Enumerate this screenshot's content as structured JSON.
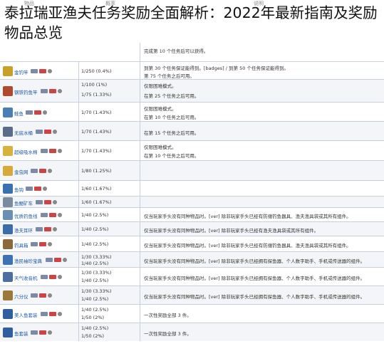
{
  "title": "泰拉瑞亚渔夫任务奖励全面解析：2022年最新指南及奖励物品总览",
  "header": {
    "col_item": "物品",
    "col_rate": "概率",
    "col_note": "说明"
  },
  "top_rows": [
    {
      "note": "完成第 10 个任务后可以获得。"
    }
  ],
  "rows": [
    {
      "name": "金钓竿",
      "rate1": "1/250 (0.4%)",
      "rate2": "",
      "note1": "到第 30 个任务保证能得到。[badges] / 到第 50 个任务保证能得到。",
      "note2": "第 75 个任务之后可用。",
      "icon": "golden-fishing-rod-icon"
    },
    {
      "name": "钢铁钓鱼竿",
      "rate1": "1/100 (1%)",
      "rate2": "1/75 (1.33%)",
      "note1": "仅限困难模式。",
      "note2": "在第 25 个任务之后可用。",
      "icon": "fishing-rod-icon"
    },
    {
      "name": "鲑鱼",
      "rate1": "1/70 (1.43%)",
      "rate2": "",
      "note1": "仅限困难模式。",
      "note2": "在第 10 个任务之后可用。",
      "icon": "fish-icon"
    },
    {
      "name": "无底水桶",
      "rate1": "1/70 (1.43%)",
      "rate2": "",
      "note1": "在第 15 个任务之后可用。",
      "note2": "",
      "icon": "bucket-icon"
    },
    {
      "name": "超级吸水棉",
      "rate1": "1/70 (1.43%)",
      "rate2": "",
      "note1": "仅限困难模式。",
      "note2": "在第 10 个任务之后可用。",
      "icon": "sponge-icon"
    },
    {
      "name": "金虫网",
      "rate1": "1/80 (1.25%)",
      "rate2": "",
      "note1": "",
      "note2": "",
      "icon": "bug-net-icon"
    },
    {
      "name": "鱼钩",
      "rate1": "1/60 (1.67%)",
      "rate2": "",
      "note1": "",
      "note2": "",
      "icon": "fish-hook-icon"
    },
    {
      "name": "鱼鳃矿车",
      "rate1": "1/60 (1.67%)",
      "rate2": "",
      "note1": "",
      "note2": "",
      "icon": "minecart-icon"
    },
    {
      "name": "优质钓鱼线",
      "rate1": "1/40 (2.5%)",
      "rate2": "",
      "note1": "仅当玩家手头没有同种物品时。[ver] 除非玩家手头已经有防缠钓鱼器具、渔夫渔具袋或其所有组件。",
      "note2": "",
      "icon": "fishing-line-icon"
    },
    {
      "name": "渔夫耳环",
      "rate1": "1/40 (2.5%)",
      "rate2": "",
      "note1": "仅当玩家手头没有同种物品时。[ver] 除非玩家手头已经有渔夫渔具袋或其所有组件。",
      "note2": "",
      "icon": "earring-icon"
    },
    {
      "name": "钓具箱",
      "rate1": "1/40 (2.5%)",
      "rate2": "",
      "note1": "仅当玩家手头没有同种物品时。[ver] 除非玩家手头已经有防缠钓鱼器具、渔夫渔具袋或其所有组件。",
      "note2": "",
      "icon": "tackle-box-icon"
    },
    {
      "name": "渔民袖珍宝典",
      "rate1": "1/30 (3.33%)",
      "rate2": "1/40 (2.5%)",
      "note1": "仅当玩家手头没有同种物品时。[ver] 除非玩家手头已经拥有探鱼器、个人数字助手、手机或传送器的组件。",
      "note2": "",
      "icon": "fishermans-guide-icon"
    },
    {
      "name": "天气收音机",
      "rate1": "1/30 (3.33%)",
      "rate2": "1/40 (2.5%)",
      "note1": "仅当玩家手头没有同种物品时。[ver] 除非玩家手头已经拥有探鱼器、个人数字助手、手机或传送器的组件。",
      "note2": "",
      "icon": "radio-icon"
    },
    {
      "name": "六分仪",
      "rate1": "1/30 (3.33%)",
      "rate2": "1/40 (2.5%)",
      "note1": "仅当玩家手头没有同种物品时。[ver] 除非玩家手头已经拥有探鱼器、个人数字助手、手机或传送器的组件。",
      "note2": "",
      "icon": "sextant-icon"
    },
    {
      "name": "美人鱼套装",
      "rate1": "1/40 (2.5%)",
      "rate2": "1/50 (2%)",
      "note1": "一次性奖励全部 3 件。",
      "note2": "",
      "icon": "mermaid-icon"
    },
    {
      "name": "鱼套装",
      "rate1": "1/40 (2.5%)",
      "rate2": "1/50 (2%)",
      "note1": "一次性奖励全部 3 件。",
      "note2": "",
      "icon": "fish-costume-icon"
    }
  ],
  "colors": {
    "link": "#1b5aa6",
    "border": "#c6cfdc",
    "row_alt": "#f3f5f8"
  }
}
